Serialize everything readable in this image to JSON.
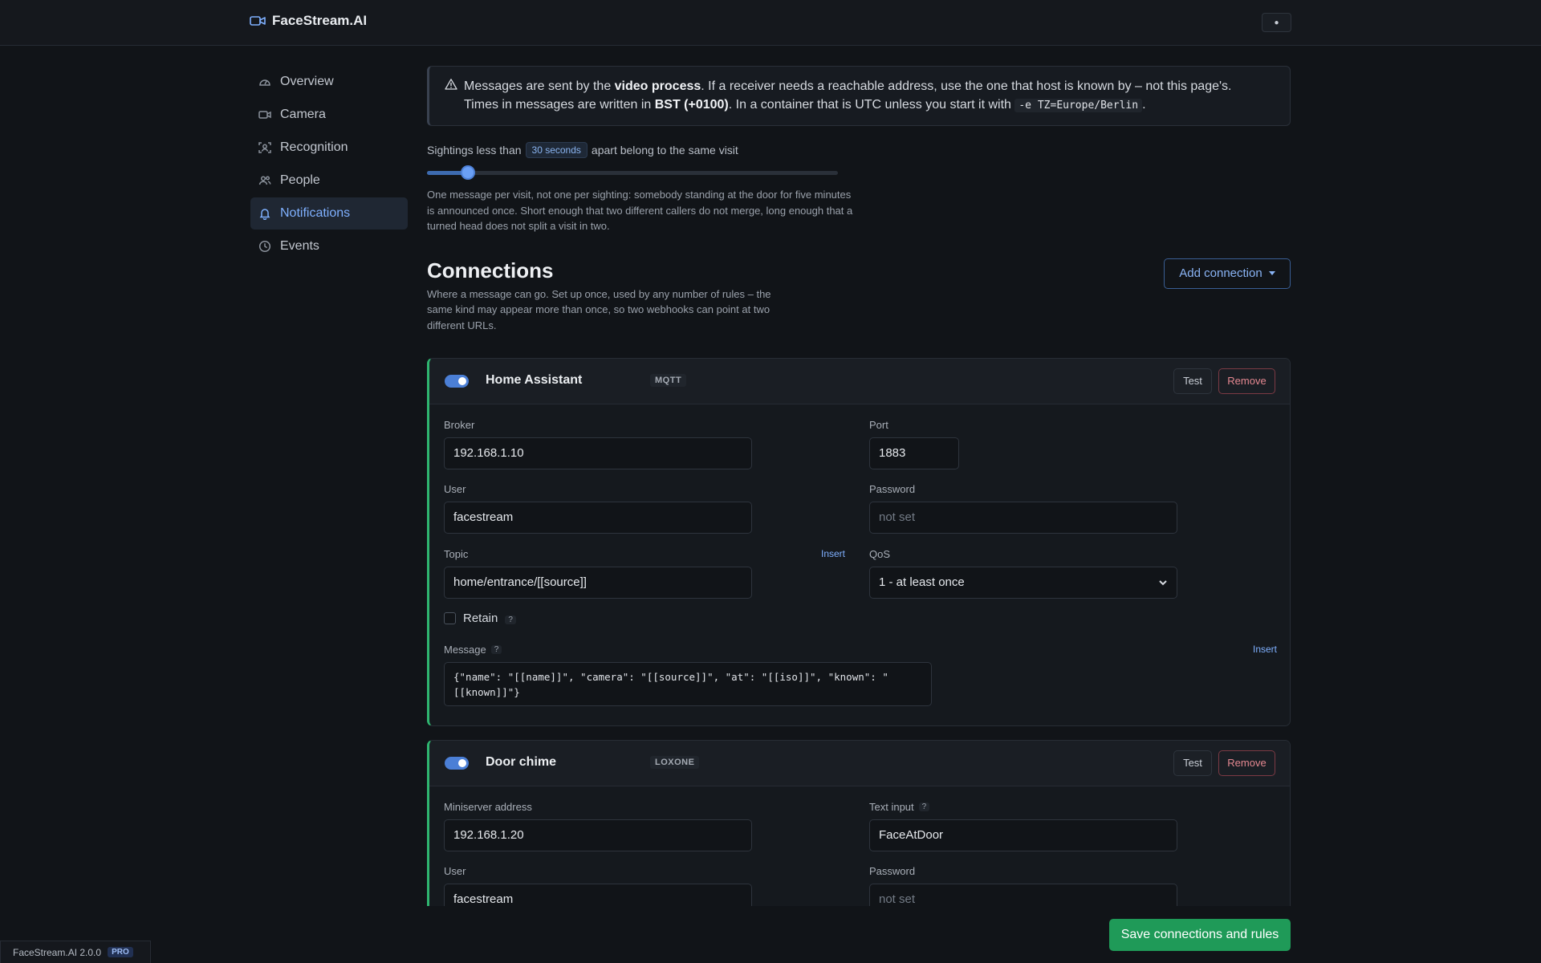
{
  "app": {
    "title": "FaceStream.AI",
    "theme_symbol": "●"
  },
  "sidebar": {
    "items": [
      {
        "label": "Overview",
        "icon": "gauge-icon",
        "active": false
      },
      {
        "label": "Camera",
        "icon": "camera-icon",
        "active": false
      },
      {
        "label": "Recognition",
        "icon": "face-scan-icon",
        "active": false
      },
      {
        "label": "People",
        "icon": "people-icon",
        "active": false
      },
      {
        "label": "Notifications",
        "icon": "bell-icon",
        "active": true
      },
      {
        "label": "Events",
        "icon": "clock-icon",
        "active": false
      }
    ]
  },
  "alert": {
    "p1": "Messages are sent by the ",
    "p1_bold": "video process",
    "p2": ". If a receiver needs a reachable address, use the one that host is known by – not this page's.",
    "p3": "Times in messages are written in ",
    "p3_bold": "BST (+0100)",
    "p4": ". In a container that is UTC unless you start it with ",
    "code": "-e TZ=Europe/Berlin",
    "p5": "."
  },
  "visit_gap": {
    "prefix": "Sightings less than",
    "value": "30 seconds",
    "suffix": "apart belong to the same visit",
    "slider_fraction": 0.1,
    "help": "One message per visit, not one per sighting: somebody standing at the door for five minutes is announced once. Short enough that two different callers do not merge, long enough that a turned head does not split a visit in two."
  },
  "connections": {
    "title": "Connections",
    "description": "Where a message can go. Set up once, used by any number of rules – the same kind may appear more than once, so two webhooks can point at two different URLs.",
    "add_label": "Add connection",
    "test_label": "Test",
    "remove_label": "Remove",
    "accent": "#2fb670",
    "mqtt": {
      "name": "Home Assistant",
      "kind": "MQTT",
      "enabled": true,
      "broker_label": "Broker",
      "broker": "192.168.1.10",
      "port_label": "Port",
      "port": "1883",
      "user_label": "User",
      "user": "facestream",
      "password_label": "Password",
      "password_placeholder": "not set",
      "topic_label": "Topic",
      "topic": "home/entrance/[[source]]",
      "insert_label": "Insert",
      "qos_label": "QoS",
      "qos": "1 - at least once",
      "retain_label": "Retain",
      "retain": false,
      "help_mark": "?",
      "message_label": "Message",
      "message": "{\"name\": \"[[name]]\", \"camera\": \"[[source]]\", \"at\": \"[[iso]]\", \"known\": \"[[known]]\"}"
    },
    "loxone": {
      "name": "Door chime",
      "kind": "LOXONE",
      "enabled": true,
      "address_label": "Miniserver address",
      "address": "192.168.1.20",
      "text_input_label": "Text input",
      "text_input": "FaceAtDoor",
      "user_label": "User",
      "user": "facestream",
      "password_label": "Password",
      "password_placeholder": "not set"
    }
  },
  "save_label": "Save connections and rules",
  "footer": {
    "version": "FaceStream.AI 2.0.0",
    "badge": "PRO"
  }
}
